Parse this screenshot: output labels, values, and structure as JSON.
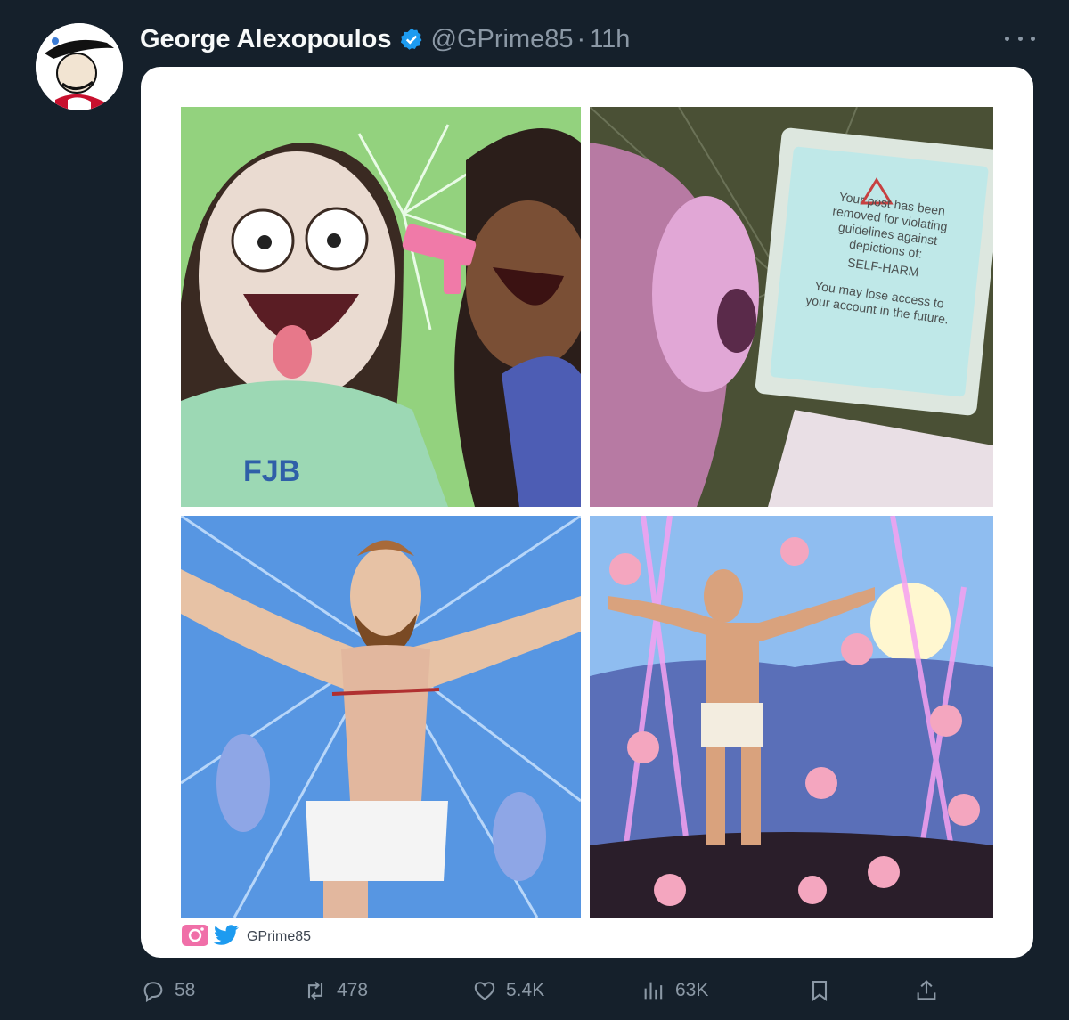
{
  "author": {
    "name": "George Alexopoulos",
    "handle": "@GPrime85",
    "separator": "·",
    "time": "11h",
    "verified": true,
    "avatar_icon": "cartoon-avatar-icon"
  },
  "media": {
    "panels": [
      {
        "id": "panel-1",
        "shirt_text": "FJB"
      },
      {
        "id": "panel-2",
        "screen_lines": [
          "Your post has been removed for violating guidelines against depictions of:",
          "SELF-HARM",
          "You may lose access to your account in the future."
        ]
      },
      {
        "id": "panel-3"
      },
      {
        "id": "panel-4"
      }
    ],
    "credit_handle": "GPrime85"
  },
  "actions": {
    "replies": "58",
    "reposts": "478",
    "likes": "5.4K",
    "views": "63K"
  },
  "colors": {
    "background": "#15202b",
    "muted": "#8b98a5",
    "text": "#f7f9f9",
    "verified": "#1d9bf0"
  }
}
